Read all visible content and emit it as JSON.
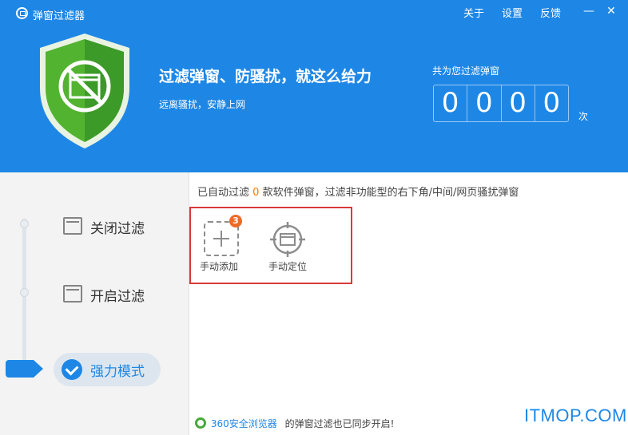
{
  "titlebar": {
    "app_title": "弹窗过滤器",
    "menu": {
      "about": "关于",
      "settings": "设置",
      "feedback": "反馈"
    },
    "minimize_glyph": "—",
    "close_glyph": "✕"
  },
  "header": {
    "slogan": "过滤弹窗、防骚扰，就这么给力",
    "subtitle": "远离骚扰，安静上网",
    "counter_label": "共为您过滤弹窗",
    "counter_digits": [
      "0",
      "0",
      "0",
      "0"
    ],
    "counter_unit": "次"
  },
  "sidebar": {
    "modes": [
      "关闭过滤",
      "开启过滤",
      "强力模式"
    ],
    "active_mode_index": 2
  },
  "main": {
    "filter_info": {
      "prefix": "已自动过滤",
      "count": "0",
      "suffix": "款软件弹窗，过滤非功能型的右下角/中间/网页骚扰弹窗"
    },
    "tools": [
      {
        "label": "手动添加",
        "badge": "3",
        "icon": "dashed-plus-icon"
      },
      {
        "label": "手动定位",
        "icon": "crosshair-window-icon"
      }
    ]
  },
  "footer": {
    "browser_name": "360安全浏览器",
    "text": "的弹窗过滤也已同步开启!"
  },
  "watermark": "ITMOP.COM",
  "colors": {
    "accent_blue": "#1e87e6",
    "shield_green": "#52b331",
    "orange": "#ff7a00",
    "highlight_red": "#d93a3a"
  }
}
